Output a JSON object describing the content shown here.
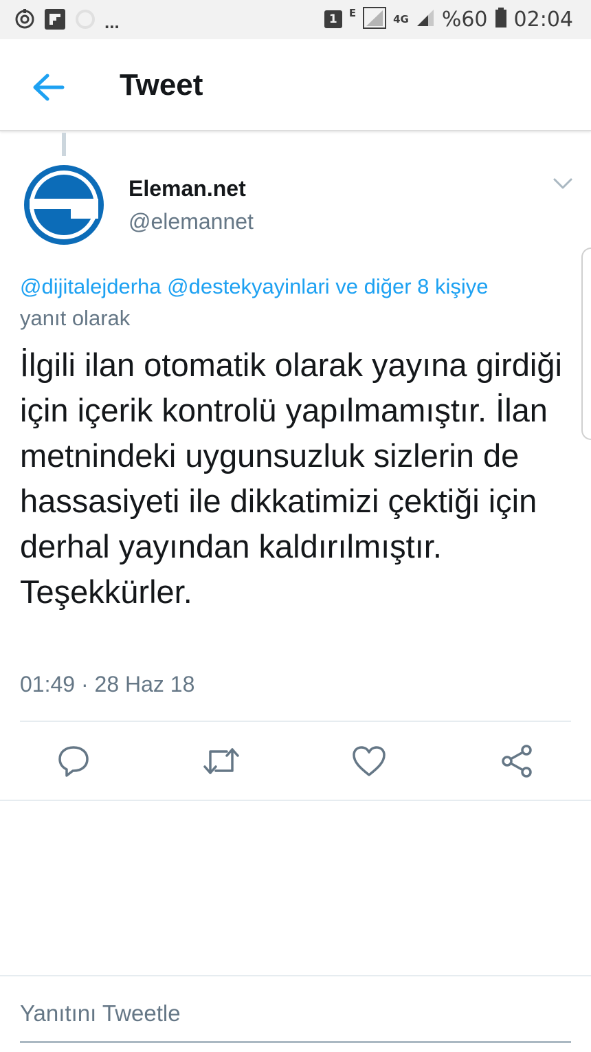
{
  "status_bar": {
    "notification_count": "1",
    "network_e": "E",
    "network_4g": "4G",
    "battery": "%60",
    "time": "02:04",
    "overflow": "..."
  },
  "header": {
    "title": "Tweet"
  },
  "tweet": {
    "author_name": "Eleman.net",
    "author_handle": "@elemannet",
    "reply_mentions": "@dijitalejderha @destekyayinlari ve diğer 8 kişiye",
    "reply_suffix": "yanıt olarak",
    "text": "İlgili ilan otomatik olarak yayına girdiği için içerik kontrolü yapılmamıştır. İlan metnindeki uygunsuzluk sizlerin de hassasiyeti ile dikkatimizi çektiği için derhal yayından kaldırılmıştır. Teşekkürler.",
    "timestamp": "01:49 · 28 Haz 18"
  },
  "composer": {
    "placeholder": "Yanıtını Tweetle"
  },
  "colors": {
    "accent": "#1da1f2",
    "secondary_text": "#657786",
    "avatar_blue": "#0c6cb8"
  }
}
